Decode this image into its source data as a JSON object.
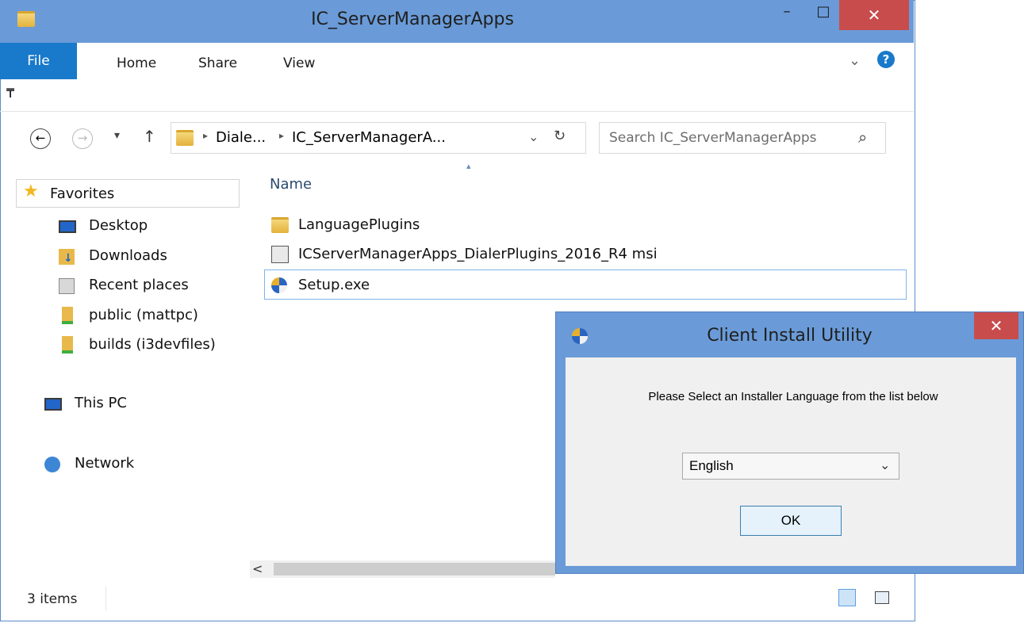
{
  "window": {
    "title": "IC_ServerManagerApps",
    "minimize": "–",
    "maximize": "□",
    "close": "✕"
  },
  "ribbon": {
    "tabs": [
      "File",
      "Home",
      "Share",
      "View"
    ],
    "expand": "⌄",
    "help": "?"
  },
  "qat": {
    "customize": "₸"
  },
  "nav": {
    "back": "←",
    "forward": "→",
    "recent": "▾",
    "up": "↑",
    "breadcrumb": [
      "Diale...",
      "IC_ServerManagerA..."
    ],
    "dropdown": "⌄",
    "refresh": "↻",
    "search_placeholder": "Search IC_ServerManagerApps",
    "search_icon": "⌕"
  },
  "sidebar": {
    "favorites": "Favorites",
    "items": [
      "Desktop",
      "Downloads",
      "Recent places",
      "public (mattpc)",
      "builds (i3devfiles)"
    ],
    "this_pc": "This PC",
    "network": "Network"
  },
  "filelist": {
    "column_header": "Name",
    "sort_indicator": "▴",
    "files": [
      "LanguagePlugins",
      "ICServerManagerApps_DialerPlugins_2016_R4 msi",
      "Setup.exe"
    ]
  },
  "status": {
    "count": "3 items",
    "scroll_left": "<"
  },
  "dialog": {
    "title": "Client Install Utility",
    "close": "✕",
    "message": "Please Select an Installer Language from the list below",
    "language": "English",
    "ok": "OK"
  },
  "colors": {
    "titlebar": "#6a9bd8",
    "close_button": "#c94c4c",
    "file_tab": "#1979ca",
    "dialog_body": "#f0f0f0"
  }
}
